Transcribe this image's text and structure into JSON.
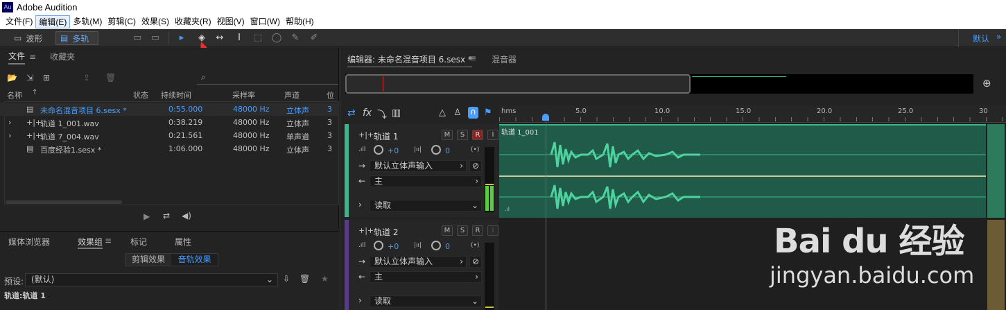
{
  "titlebar": {
    "logo": "Au",
    "title": "Adobe Audition"
  },
  "menu": [
    "文件(F)",
    "编辑(E)",
    "多轨(M)",
    "剪辑(C)",
    "效果(S)",
    "收藏夹(R)",
    "视图(V)",
    "窗口(W)",
    "帮助(H)"
  ],
  "toolbar": {
    "waveform": "波形",
    "multitrack": "多轨",
    "workspace": "默认"
  },
  "files_panel": {
    "tabs": [
      "文件",
      "收藏夹"
    ],
    "columns": [
      "名称",
      "状态",
      "持续时间",
      "采样率",
      "声道",
      "位"
    ],
    "rows": [
      {
        "name": "未命名混音项目 6.sesx *",
        "duration": "0:55.000",
        "rate": "48000 Hz",
        "channels": "立体声",
        "bit": "3"
      },
      {
        "name": "轨道 1_001.wav",
        "duration": "0:38.219",
        "rate": "48000 Hz",
        "channels": "立体声",
        "bit": "3"
      },
      {
        "name": "轨道 7_004.wav",
        "duration": "0:21.561",
        "rate": "48000 Hz",
        "channels": "单声道",
        "bit": "3"
      },
      {
        "name": "百度经验1.sesx *",
        "duration": "1:06.000",
        "rate": "48000 Hz",
        "channels": "立体声",
        "bit": "3"
      }
    ]
  },
  "bottom_panel": {
    "tabs": [
      "媒体浏览器",
      "效果组",
      "标记",
      "属性"
    ],
    "subtabs": [
      "剪辑效果",
      "音轨效果"
    ],
    "preset_label": "预设:",
    "preset_value": "(默认)",
    "track_label": "轨道:轨道 1"
  },
  "editor": {
    "tab_editor": "编辑器: 未命名混音项目 6.sesx *",
    "tab_mixer": "混音器",
    "ruler": {
      "unit": "hms",
      "ticks": [
        "5.0",
        "10.0",
        "15.0",
        "20.0",
        "25.0",
        "30"
      ]
    },
    "playhead_seconds": 2.8,
    "tracks": [
      {
        "name": "轨道 1",
        "vol": "+0",
        "pan": "0",
        "input": "默认立体声输入",
        "output": "主",
        "mode": "读取",
        "clip": "轨道 1_001",
        "color": "#3db58b"
      },
      {
        "name": "轨道 2",
        "vol": "+0",
        "pan": "0",
        "input": "默认立体声输入",
        "output": "主",
        "mode": "读取",
        "clip": "",
        "color": "#5a3a8c"
      }
    ]
  },
  "watermark": {
    "text": "Bai du 经验",
    "url": "jingyan.baidu.com"
  }
}
